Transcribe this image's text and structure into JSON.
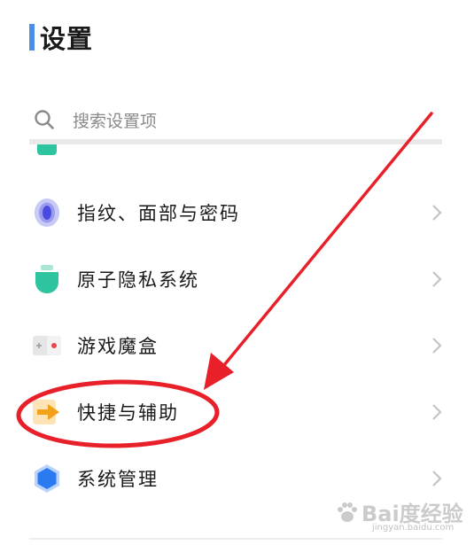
{
  "header": {
    "title": "设置",
    "accent_color": "#4a8ee8"
  },
  "search": {
    "placeholder": "搜索设置项",
    "icon": "search-icon"
  },
  "partial_item": {
    "label": "",
    "icon": "app-icon"
  },
  "list": {
    "items": [
      {
        "label": "指纹、面部与密码",
        "icon": "fingerprint-icon"
      },
      {
        "label": "原子隐私系统",
        "icon": "privacy-shield-icon"
      },
      {
        "label": "游戏魔盒",
        "icon": "game-box-icon"
      },
      {
        "label": "快捷与辅助",
        "icon": "shortcut-arrow-icon"
      },
      {
        "label": "系统管理",
        "icon": "system-hexagon-icon"
      }
    ]
  },
  "annotation": {
    "color": "#e8202a",
    "shapes": [
      "highlight-ellipse",
      "pointer-arrow"
    ]
  },
  "watermark": {
    "brand": "Bai度经验",
    "url": "jingyan.baidu.com"
  }
}
